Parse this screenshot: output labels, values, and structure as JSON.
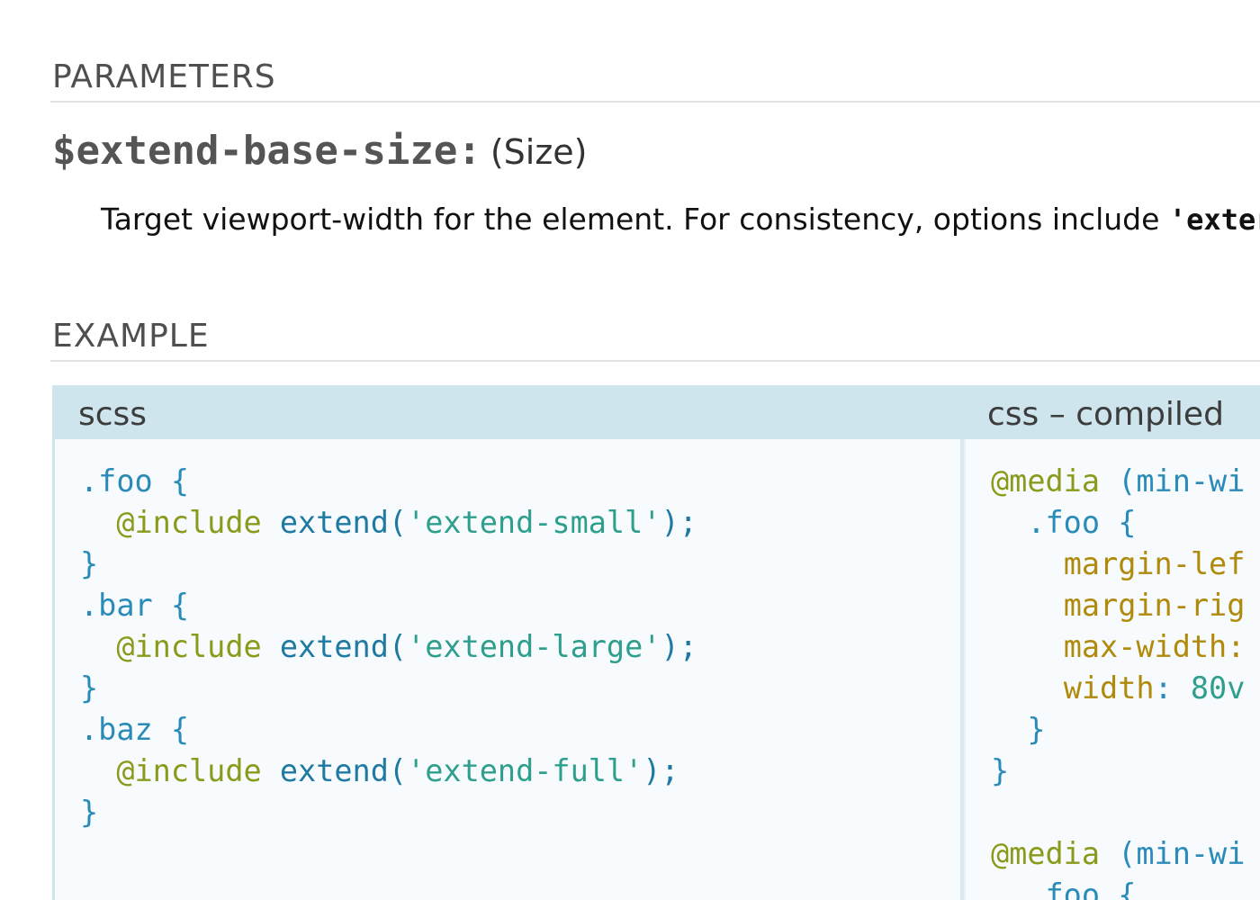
{
  "parameters": {
    "heading": "PARAMETERS",
    "param": {
      "name": "$extend-base-size:",
      "type": "(Size)",
      "description": "Target viewport-width for the element. For consistency, options include ",
      "description_code": "'exter"
    }
  },
  "example": {
    "heading": "EXAMPLE",
    "scss_label": "scss",
    "css_label": "css – compiled",
    "scss_lines": [
      [
        {
          "t": ".foo",
          "c": "sel"
        },
        {
          "t": " {",
          "c": "punc"
        }
      ],
      [
        {
          "t": "  ",
          "c": "punc"
        },
        {
          "t": "@include",
          "c": "at"
        },
        {
          "t": " extend(",
          "c": "fn"
        },
        {
          "t": "'extend-small'",
          "c": "str"
        },
        {
          "t": ");",
          "c": "fn"
        }
      ],
      [
        {
          "t": "}",
          "c": "punc"
        }
      ],
      [
        {
          "t": ".bar",
          "c": "sel"
        },
        {
          "t": " {",
          "c": "punc"
        }
      ],
      [
        {
          "t": "  ",
          "c": "punc"
        },
        {
          "t": "@include",
          "c": "at"
        },
        {
          "t": " extend(",
          "c": "fn"
        },
        {
          "t": "'extend-large'",
          "c": "str"
        },
        {
          "t": ");",
          "c": "fn"
        }
      ],
      [
        {
          "t": "}",
          "c": "punc"
        }
      ],
      [
        {
          "t": ".baz",
          "c": "sel"
        },
        {
          "t": " {",
          "c": "punc"
        }
      ],
      [
        {
          "t": "  ",
          "c": "punc"
        },
        {
          "t": "@include",
          "c": "at"
        },
        {
          "t": " extend(",
          "c": "fn"
        },
        {
          "t": "'extend-full'",
          "c": "str"
        },
        {
          "t": ");",
          "c": "fn"
        }
      ],
      [
        {
          "t": "}",
          "c": "punc"
        }
      ]
    ],
    "css_lines": [
      [
        {
          "t": "@media",
          "c": "at"
        },
        {
          "t": " (min-wi",
          "c": "punc"
        }
      ],
      [
        {
          "t": "  ",
          "c": "punc"
        },
        {
          "t": ".foo",
          "c": "sel"
        },
        {
          "t": " {",
          "c": "punc"
        }
      ],
      [
        {
          "t": "    ",
          "c": "punc"
        },
        {
          "t": "margin-lef",
          "c": "prop"
        }
      ],
      [
        {
          "t": "    ",
          "c": "punc"
        },
        {
          "t": "margin-rig",
          "c": "prop"
        }
      ],
      [
        {
          "t": "    ",
          "c": "punc"
        },
        {
          "t": "max-width:",
          "c": "prop"
        }
      ],
      [
        {
          "t": "    ",
          "c": "punc"
        },
        {
          "t": "width",
          "c": "prop"
        },
        {
          "t": ": ",
          "c": "punc"
        },
        {
          "t": "80v",
          "c": "num"
        }
      ],
      [
        {
          "t": "  }",
          "c": "punc"
        }
      ],
      [
        {
          "t": "}",
          "c": "punc"
        }
      ],
      [
        {
          "t": "",
          "c": "punc"
        }
      ],
      [
        {
          "t": "@media",
          "c": "at"
        },
        {
          "t": " (min-wi",
          "c": "punc"
        }
      ],
      [
        {
          "t": "  ",
          "c": "punc"
        },
        {
          "t": ".foo",
          "c": "sel"
        },
        {
          "t": " {",
          "c": "punc"
        }
      ]
    ]
  }
}
